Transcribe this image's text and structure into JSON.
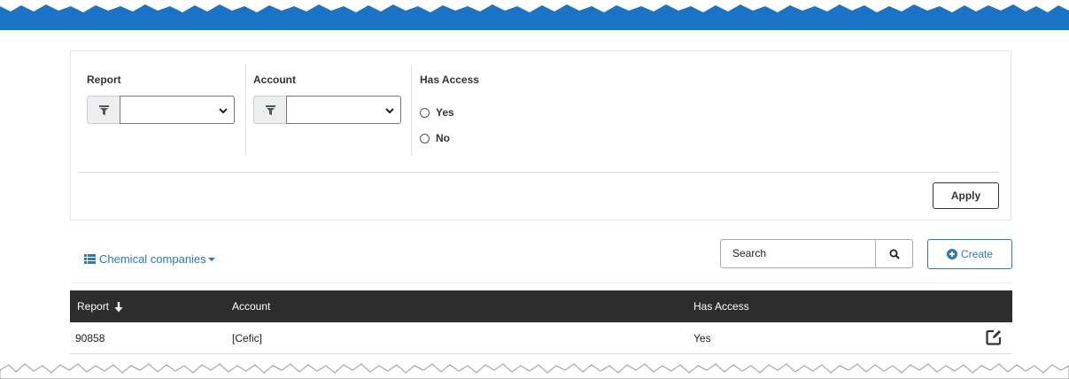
{
  "filters": {
    "report": {
      "label": "Report",
      "value": ""
    },
    "account": {
      "label": "Account",
      "value": ""
    },
    "has_access": {
      "label": "Has Access",
      "options": [
        {
          "label": "Yes",
          "selected": false
        },
        {
          "label": "No",
          "selected": false
        }
      ]
    },
    "apply_label": "Apply",
    "filter_icon": "funnel-icon"
  },
  "toolbar": {
    "view_label": "Chemical companies",
    "view_icon": "list-icon",
    "search_value": "Search",
    "search_icon": "magnifier-icon",
    "create_label": "Create",
    "create_icon": "plus-circle-icon"
  },
  "table": {
    "columns": [
      "Report",
      "Account",
      "Has Access"
    ],
    "sorted_column": "Report",
    "sort_direction": "descending",
    "rows": [
      {
        "report": "90858",
        "account": "[Cefic]",
        "has_access": "Yes"
      }
    ],
    "row_action_icon": "edit-icon"
  },
  "colors": {
    "accent": "#2a7ab8",
    "header_band": "#1a73c4",
    "table_header_bg": "#2d2d2d"
  }
}
